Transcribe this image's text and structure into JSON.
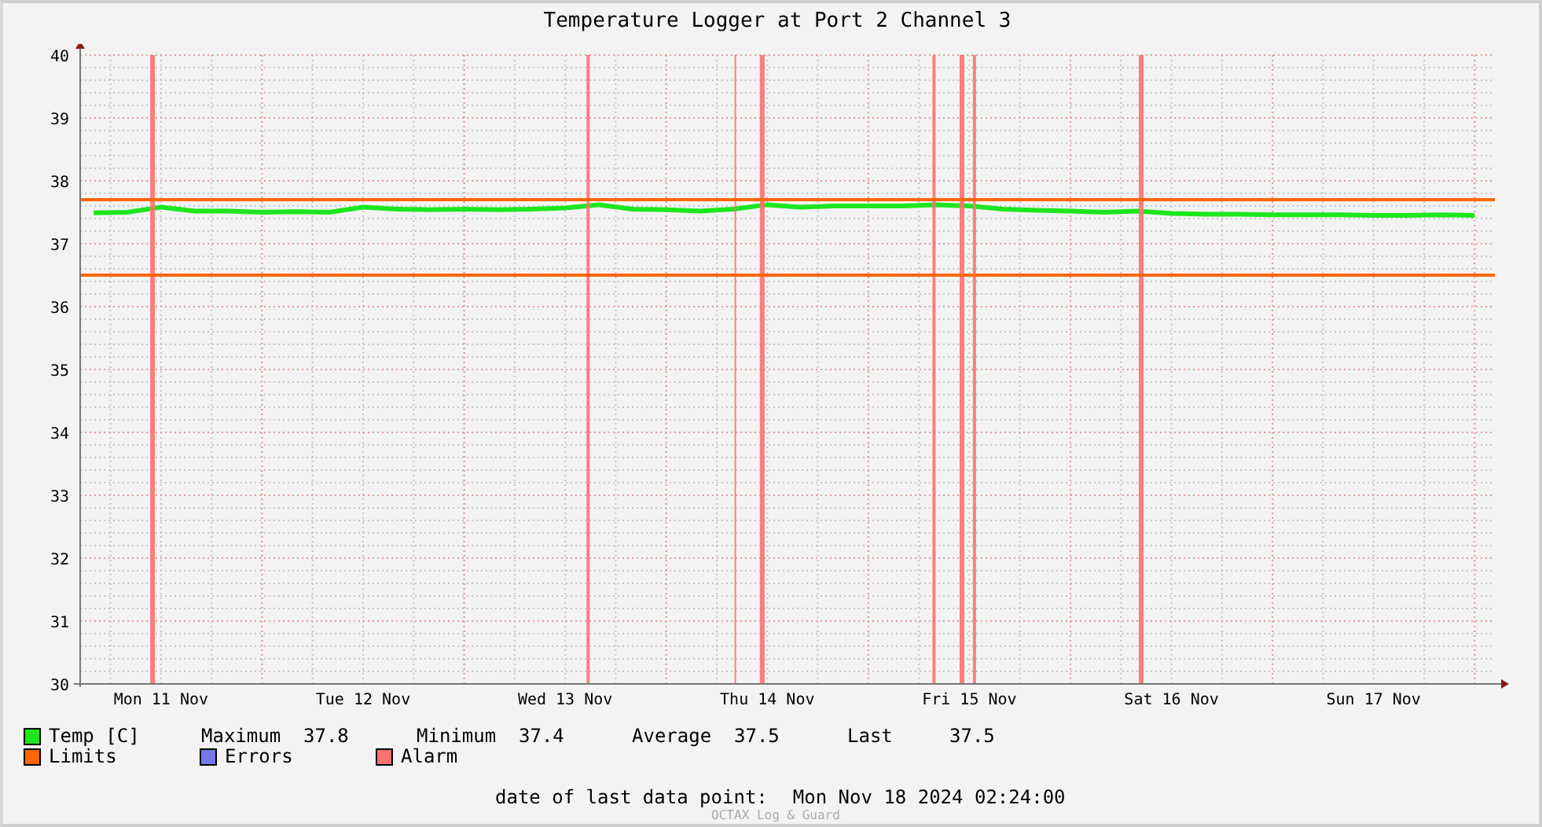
{
  "title": "Temperature Logger at Port 2 Channel 3",
  "chart_data": {
    "type": "line",
    "categories": [
      null,
      null,
      "Mon 11 Nov",
      null,
      null,
      null,
      null,
      null,
      "Tue 12 Nov",
      null,
      null,
      null,
      null,
      null,
      "Wed 13 Nov",
      null,
      null,
      null,
      null,
      null,
      "Thu 14 Nov",
      null,
      null,
      null,
      null,
      null,
      "Fri 15 Nov",
      null,
      null,
      null,
      null,
      null,
      "Sat 16 Nov",
      null,
      null,
      null,
      null,
      null,
      "Sun 17 Nov",
      null,
      null,
      null
    ],
    "series": [
      {
        "name": "Temp [C]",
        "color": "#1ee61e",
        "values": [
          37.49,
          37.5,
          37.58,
          37.52,
          37.52,
          37.5,
          37.51,
          37.5,
          37.58,
          37.55,
          37.54,
          37.55,
          37.54,
          37.55,
          37.57,
          37.62,
          37.55,
          37.54,
          37.52,
          37.55,
          37.62,
          37.58,
          37.6,
          37.6,
          37.6,
          37.62,
          37.6,
          37.55,
          37.53,
          37.52,
          37.5,
          37.52,
          37.48,
          37.47,
          37.47,
          37.46,
          37.46,
          37.46,
          37.45,
          37.45,
          37.46,
          37.45
        ]
      }
    ],
    "ylim": [
      30,
      40
    ],
    "grid": true,
    "yticks": [
      30,
      31,
      32,
      33,
      34,
      35,
      36,
      37,
      38,
      39,
      40
    ],
    "ref_lines": [
      {
        "axis": "y",
        "value": 37.7,
        "color": "#ff6600"
      },
      {
        "axis": "y",
        "value": 36.5,
        "color": "#ff6600"
      }
    ]
  },
  "legend": [
    {
      "label": "Limits",
      "color": "#ff6600"
    },
    {
      "label": "Errors",
      "color": "#7777ee"
    },
    {
      "label": "Alarm",
      "color": "#ff7070"
    }
  ],
  "stats": [
    {
      "label": "Maximum",
      "value": "37.8"
    },
    {
      "label": "Minimum",
      "value": "37.4"
    },
    {
      "label": "Average",
      "value": "37.5"
    },
    {
      "label": "Last",
      "value": "37.5"
    }
  ],
  "footer": {
    "label": "date of last data point:",
    "value": "Mon Nov 18 2024 02:24:00"
  },
  "credit": "OCTAX Log & Guard"
}
